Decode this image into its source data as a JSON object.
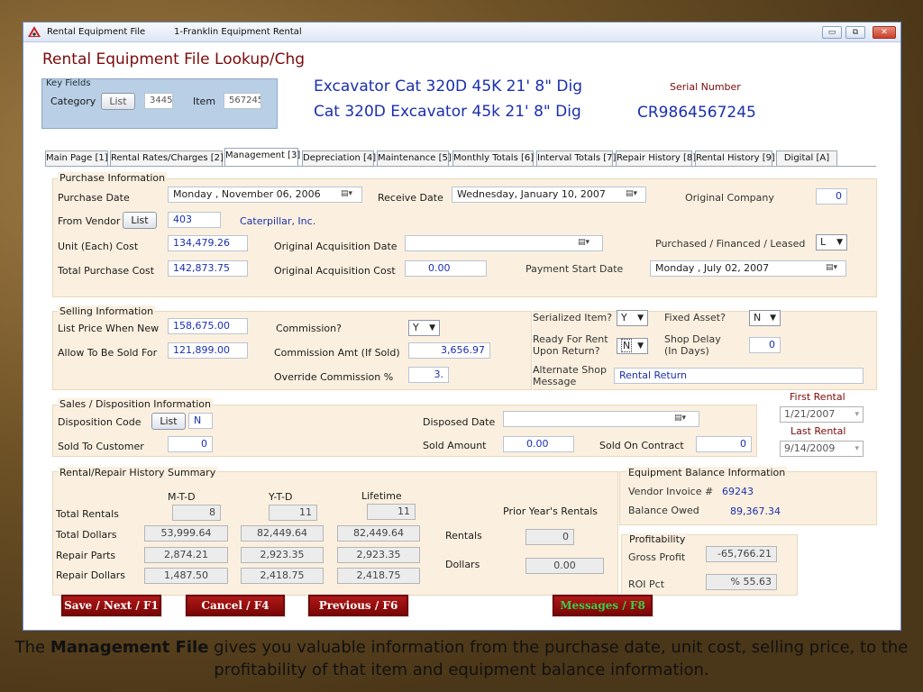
{
  "window": {
    "title": "Rental Equipment File",
    "subtitle": "1-Franklin Equipment Rental",
    "min": "▭",
    "max": "⧉",
    "close": "✕"
  },
  "page_title": "Rental Equipment File Lookup/Chg",
  "key_fields": {
    "legend": "Key Fields",
    "category_label": "Category",
    "list_button": "List",
    "category_value": "3445",
    "item_label": "Item",
    "item_value": "567245"
  },
  "header": {
    "description1": "Excavator Cat 320D 45K 21' 8\" Dig",
    "description2": "Cat 320D Excavator 45k 21' 8\" Dig",
    "serial_label": "Serial Number",
    "serial_value": "CR9864567245"
  },
  "tabs": [
    {
      "label": "Main Page [1]"
    },
    {
      "label": "Rental Rates/Charges [2]"
    },
    {
      "label": "Management [3]"
    },
    {
      "label": "Depreciation [4]"
    },
    {
      "label": "Maintenance [5]"
    },
    {
      "label": "Monthly Totals [6]"
    },
    {
      "label": "Interval Totals [7]"
    },
    {
      "label": "Repair History [8]"
    },
    {
      "label": "Rental History [9]"
    },
    {
      "label": "Digital [A]"
    }
  ],
  "purchase": {
    "title": "Purchase Information",
    "purchase_date_label": "Purchase Date",
    "purchase_date": "Monday   , November 06, 2006",
    "receive_date_label": "Receive Date",
    "receive_date": "Wednesday,  January  10, 2007",
    "original_company_label": "Original Company",
    "original_company": "0",
    "from_vendor_label": "From Vendor",
    "list_button": "List",
    "vendor_code": "403",
    "vendor_name": "Caterpillar, Inc.",
    "unit_cost_label": "Unit (Each) Cost",
    "unit_cost": "134,479.26",
    "orig_acq_date_label": "Original Acquisition Date",
    "orig_acq_date": "",
    "pfl_label": "Purchased / Financed / Leased",
    "pfl_value": "L",
    "total_cost_label": "Total Purchase Cost",
    "total_cost": "142,873.75",
    "orig_acq_cost_label": "Original Acquisition Cost",
    "orig_acq_cost": "0.00",
    "payment_start_label": "Payment Start Date",
    "payment_start": "Monday   ,      July      02, 2007"
  },
  "selling": {
    "title": "Selling Information",
    "list_price_label": "List Price When New",
    "list_price": "158,675.00",
    "commission_label": "Commission?",
    "commission": "Y",
    "allow_label": "Allow To Be Sold For",
    "allow": "121,899.00",
    "comm_amt_label": "Commission Amt (If Sold)",
    "comm_amt": "3,656.97",
    "override_label": "Override Commission %",
    "override": "3.",
    "serialized_label": "Serialized Item?",
    "serialized": "Y",
    "fixed_label": "Fixed Asset?",
    "fixed": "N",
    "ready1": "Ready For Rent",
    "ready2": "Upon Return?",
    "ready": "N",
    "delay1": "Shop Delay",
    "delay2": "(In Days)",
    "delay": "0",
    "alt1": "Alternate Shop",
    "alt2": "Message",
    "alt": "Rental Return"
  },
  "sales": {
    "title": "Sales / Disposition Information",
    "disp_code_label": "Disposition Code",
    "list_button": "List",
    "disp_code": "N",
    "disposed_date_label": "Disposed Date",
    "disposed_date": "",
    "sold_cust_label": "Sold To Customer",
    "sold_cust": "0",
    "sold_amt_label": "Sold Amount",
    "sold_amt": "0.00",
    "sold_contract_label": "Sold On Contract",
    "sold_contract": "0",
    "first_rental_label": "First Rental",
    "first_rental": "1/21/2007",
    "last_rental_label": "Last Rental",
    "last_rental": "9/14/2009"
  },
  "history": {
    "title": "Rental/Repair History Summary",
    "col_mtd": "M-T-D",
    "col_ytd": "Y-T-D",
    "col_life": "Lifetime",
    "rows": [
      {
        "label": "Total Rentals",
        "mtd": "8",
        "ytd": "11",
        "life": "11"
      },
      {
        "label": "Total Dollars",
        "mtd": "53,999.64",
        "ytd": "82,449.64",
        "life": "82,449.64"
      },
      {
        "label": "Repair Parts",
        "mtd": "2,874.21",
        "ytd": "2,923.35",
        "life": "2,923.35"
      },
      {
        "label": "Repair Dollars",
        "mtd": "1,487.50",
        "ytd": "2,418.75",
        "life": "2,418.75"
      }
    ],
    "prior_label": "Prior Year's Rentals",
    "rentals_label": "Rentals",
    "rentals": "0",
    "dollars_label": "Dollars",
    "dollars": "0.00"
  },
  "balance": {
    "title": "Equipment Balance Information",
    "invoice_label": "Vendor Invoice #",
    "invoice": "69243",
    "owed_label": "Balance Owed",
    "owed": "89,367.34"
  },
  "profit": {
    "title": "Profitability",
    "gross_label": "Gross Profit",
    "gross": "-65,766.21",
    "roi_label": "ROI Pct",
    "roi": "%  55.63"
  },
  "buttons": {
    "save": "Save / Next / F1",
    "cancel": "Cancel / F4",
    "previous": "Previous / F6",
    "messages": "Messages / F8"
  },
  "caption": {
    "pre": "The ",
    "bold": "Management File",
    "post": " gives you valuable information from the purchase date, unit cost, selling price, to the profitability of that item and equipment balance information."
  },
  "colors": {
    "accent_red": "#8b0a0a",
    "messages_text": "#35d14a",
    "value_blue": "#1a2fae",
    "panel": "#fbf0df",
    "key_fields_bg": "#b9cfe6"
  }
}
